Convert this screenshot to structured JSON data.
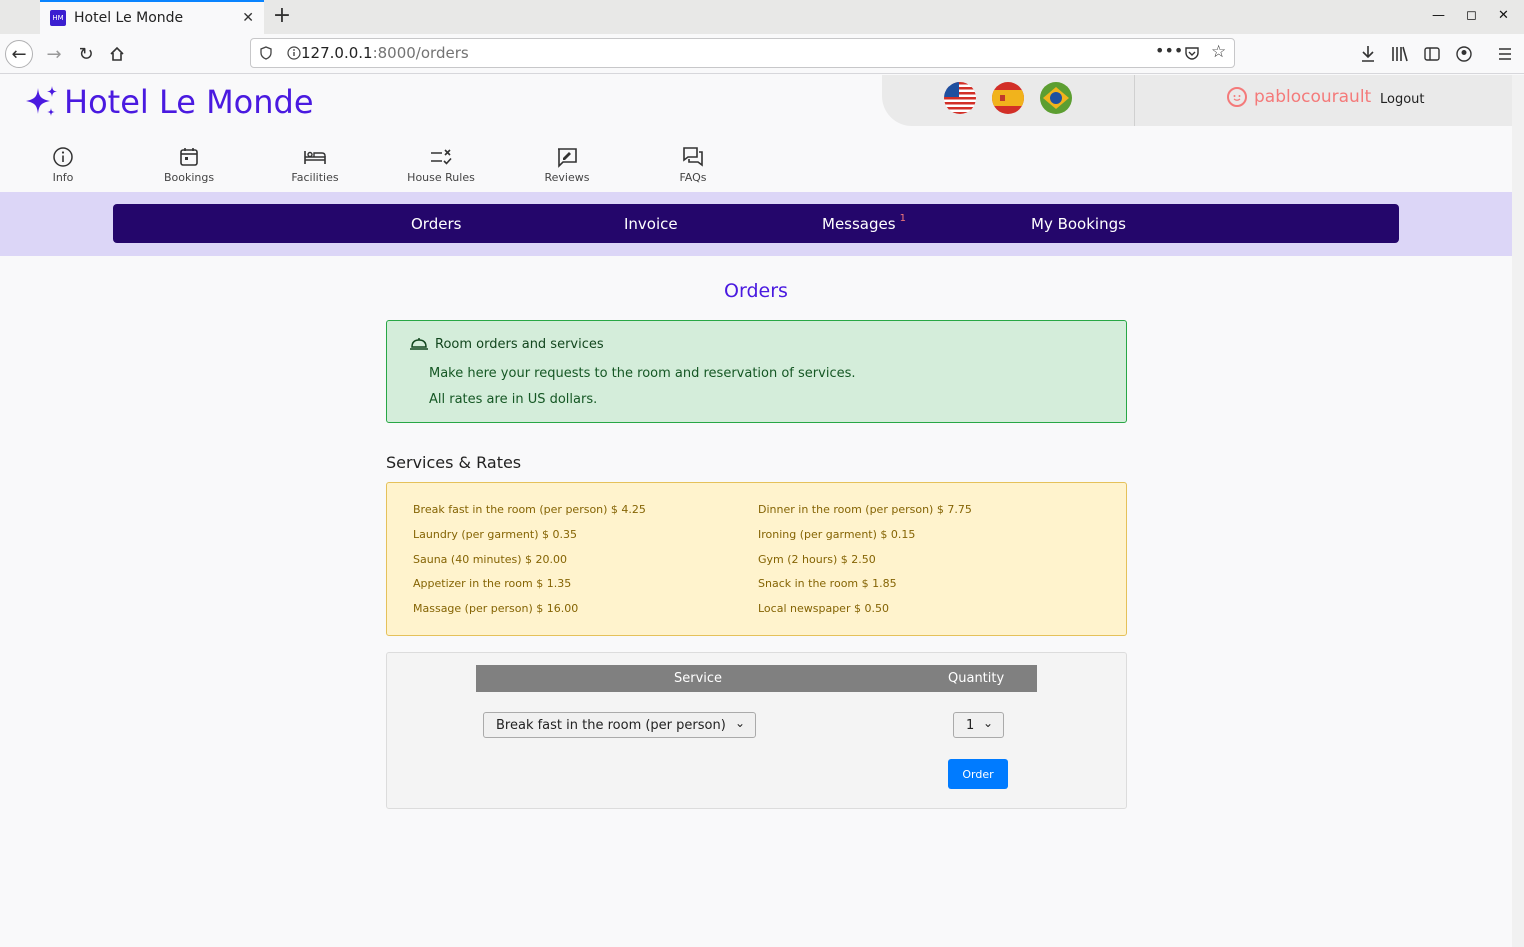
{
  "browser": {
    "tab_title": "Hotel Le Monde",
    "favicon_text": "HM",
    "url_host": "127.0.0.1",
    "url_path": ":8000/orders"
  },
  "site": {
    "logo_text": "Hotel Le Monde",
    "flags": [
      "us-flag",
      "spain-flag",
      "brazil-flag"
    ],
    "username": "pablocourault",
    "logout": "Logout"
  },
  "icon_nav": [
    {
      "label": "Info",
      "icon": "info-icon"
    },
    {
      "label": "Bookings",
      "icon": "calendar-icon"
    },
    {
      "label": "Facilities",
      "icon": "bed-icon"
    },
    {
      "label": "House Rules",
      "icon": "rules-icon"
    },
    {
      "label": "Reviews",
      "icon": "review-icon"
    },
    {
      "label": "FAQs",
      "icon": "chat-icon"
    }
  ],
  "menu": {
    "orders": "Orders",
    "invoice": "Invoice",
    "messages": "Messages",
    "messages_badge": "1",
    "my_bookings": "My Bookings"
  },
  "page_title": "Orders",
  "alert": {
    "heading": "Room orders and services",
    "line1": "Make here your requests to the room and reservation of services.",
    "line2": "All rates are in US dollars."
  },
  "services_heading": "Services & Rates",
  "rates": [
    [
      "Break fast in the room (per person) $ 4.25",
      "Dinner in the room (per person) $ 7.75"
    ],
    [
      "Laundry (per garment) $ 0.35",
      "Ironing (per garment) $ 0.15"
    ],
    [
      "Sauna (40 minutes) $ 20.00",
      "Gym (2 hours) $ 2.50"
    ],
    [
      "Appetizer in the room $ 1.35",
      "Snack in the room $ 1.85"
    ],
    [
      "Massage (per person) $ 16.00",
      "Local newspaper $ 0.50"
    ]
  ],
  "order_form": {
    "col_service": "Service",
    "col_quantity": "Quantity",
    "service_selected": "Break fast in the room (per person)",
    "quantity_selected": "1",
    "order_button": "Order"
  }
}
